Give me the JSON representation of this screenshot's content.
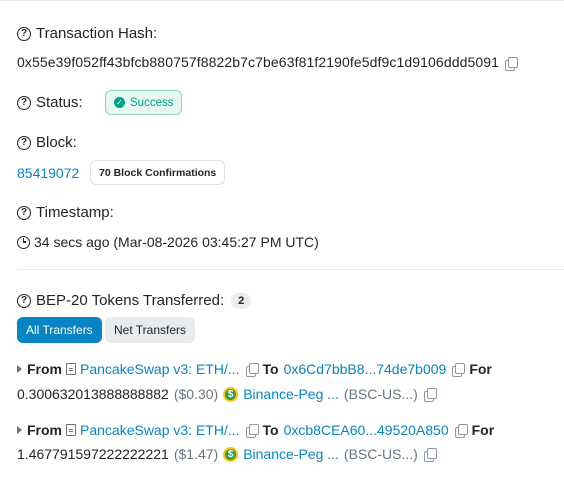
{
  "hash": {
    "label": "Transaction Hash:",
    "value": "0x55e39f052ff43bfcb880757f8822b7c7be63f81f2190fe5df9c1d9106ddd5091"
  },
  "status": {
    "label": "Status:",
    "badge": "Success",
    "badge_color": "#00a186"
  },
  "block": {
    "label": "Block:",
    "number": "85419072",
    "confirmations": "70 Block Confirmations"
  },
  "timestamp": {
    "label": "Timestamp:",
    "value": "34 secs ago (Mar-08-2026 03:45:27 PM UTC)"
  },
  "tokens": {
    "label": "BEP-20 Tokens Transferred:",
    "count": "2",
    "tabs": [
      {
        "label": "All Transfers",
        "active": true
      },
      {
        "label": "Net Transfers",
        "active": false
      }
    ],
    "transfers": [
      {
        "from_label": "From",
        "from": "PancakeSwap v3: ETH/...",
        "to_label": "To",
        "to": "0x6Cd7bbB8...74de7b009",
        "for_label": "For",
        "amount": "0.300632013888888882",
        "usd": "($0.30)",
        "token": "Binance-Peg ...",
        "token_symbol": "(BSC-US...)"
      },
      {
        "from_label": "From",
        "from": "PancakeSwap v3: ETH/...",
        "to_label": "To",
        "to": "0xcb8CEA60...49520A850",
        "for_label": "For",
        "amount": "1.467791597222222221",
        "usd": "($1.47)",
        "token": "Binance-Peg ...",
        "token_symbol": "(BSC-US...)"
      }
    ]
  },
  "colors": {
    "link": "#0784c3",
    "accent": "#0784c3",
    "success": "#00a186"
  }
}
